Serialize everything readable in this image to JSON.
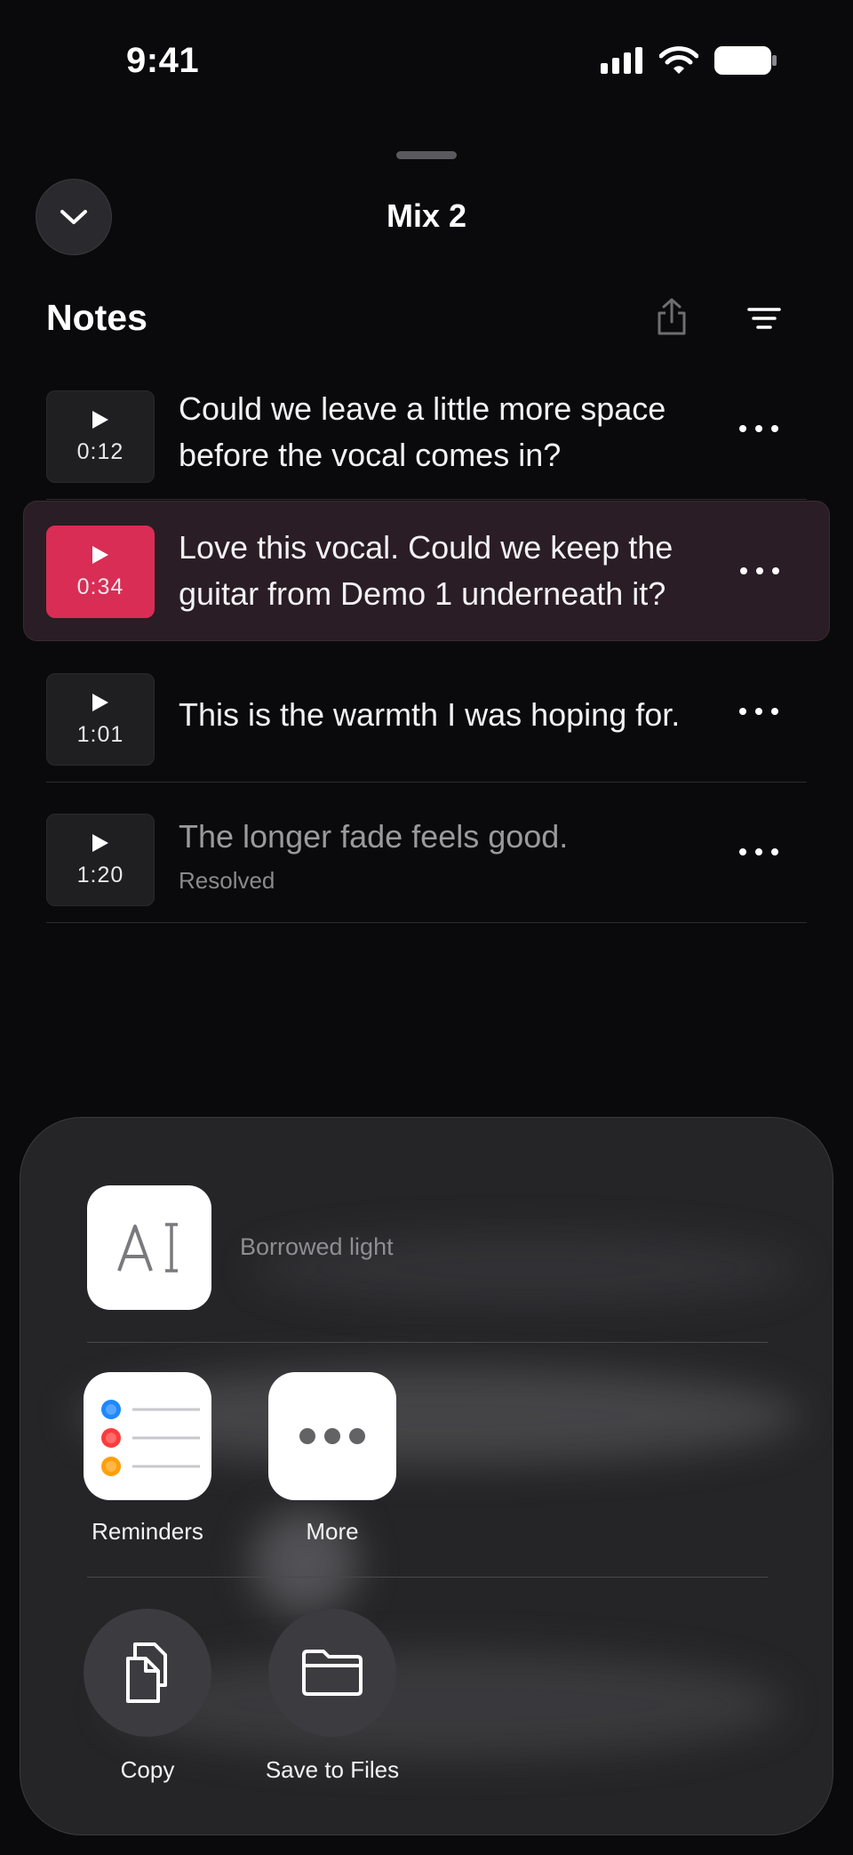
{
  "status_bar": {
    "time": "9:41"
  },
  "header": {
    "title": "Mix 2"
  },
  "notes_section": {
    "title": "Notes",
    "items": [
      {
        "duration": "0:12",
        "text": "Could we leave a little more space before the vocal comes in?",
        "status": "",
        "active": false
      },
      {
        "duration": "0:34",
        "text": "Love this vocal. Could we keep the guitar from Demo 1 underneath it?",
        "status": "",
        "active": true
      },
      {
        "duration": "1:01",
        "text": "This is the warmth I was hoping for.",
        "status": "",
        "active": false
      },
      {
        "duration": "1:20",
        "text": "The longer fade feels good.",
        "status": "Resolved",
        "active": false
      }
    ]
  },
  "share_sheet": {
    "document_name": "Borrowed light",
    "apps": [
      {
        "label": "Reminders",
        "icon": "reminders-icon"
      },
      {
        "label": "More",
        "icon": "more-icon"
      }
    ],
    "actions": [
      {
        "label": "Copy",
        "icon": "copy-icon"
      },
      {
        "label": "Save to Files",
        "icon": "folder-icon"
      }
    ]
  },
  "colors": {
    "accent": "#d92d55",
    "active_row": "#2a1d25",
    "background": "#0a0a0c"
  }
}
